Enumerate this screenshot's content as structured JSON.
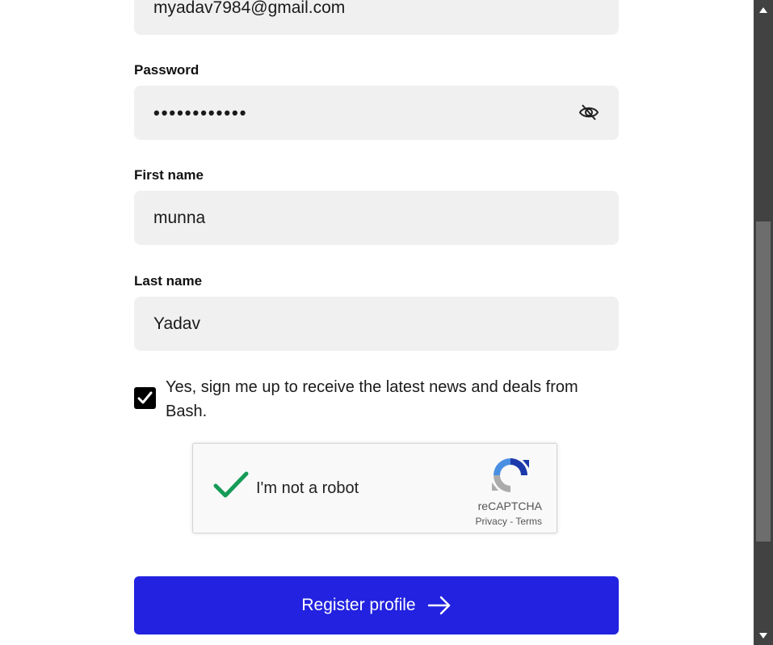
{
  "form": {
    "email": {
      "value": "myadav7984@gmail.com"
    },
    "password": {
      "label": "Password",
      "value": "••••••••••••",
      "toggle_icon": "eye-off-icon"
    },
    "first_name": {
      "label": "First name",
      "value": "munna"
    },
    "last_name": {
      "label": "Last name",
      "value": "Yadav"
    },
    "newsletter": {
      "checked": true,
      "label": "Yes, sign me up to receive the latest news and deals from Bash."
    },
    "recaptcha": {
      "label": "I'm not a robot",
      "brand": "reCAPTCHA",
      "privacy": "Privacy",
      "separator": "-",
      "terms": "Terms",
      "checked": true
    },
    "submit": {
      "label": "Register profile",
      "icon": "arrow-right-icon"
    }
  },
  "colors": {
    "field_bg": "#f0f0f0",
    "button_bg": "#2222e0",
    "check_green": "#169c58",
    "scrollbar_track": "#424242",
    "scrollbar_thumb": "#6d6d6d"
  }
}
